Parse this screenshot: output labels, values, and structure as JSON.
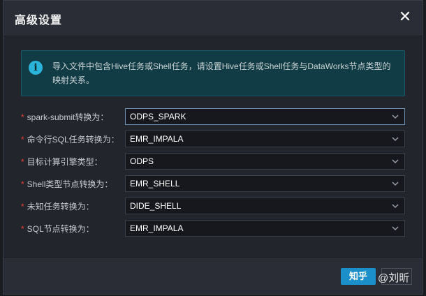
{
  "dialog": {
    "title": "高级设置",
    "close_glyph": "✕"
  },
  "notice": {
    "icon": "info-icon",
    "icon_glyph": "i",
    "text": "导入文件中包含Hive任务或Shell任务，请设置Hive任务或Shell任务与DataWorks节点类型的映射关系。"
  },
  "form": {
    "required_mark": "*",
    "fields": [
      {
        "label": "spark-submit转换为：",
        "value": "ODPS_SPARK"
      },
      {
        "label": "命令行SQL任务转换为：",
        "value": "EMR_IMPALA"
      },
      {
        "label": "目标计算引擎类型：",
        "value": "ODPS"
      },
      {
        "label": "Shell类型节点转换为：",
        "value": "EMR_SHELL"
      },
      {
        "label": "未知任务转换为：",
        "value": "DIDE_SHELL"
      },
      {
        "label": "SQL节点转换为：",
        "value": "EMR_IMPALA"
      }
    ]
  },
  "footer": {
    "ok_label": "知乎",
    "watermark": "@刘昕"
  }
}
